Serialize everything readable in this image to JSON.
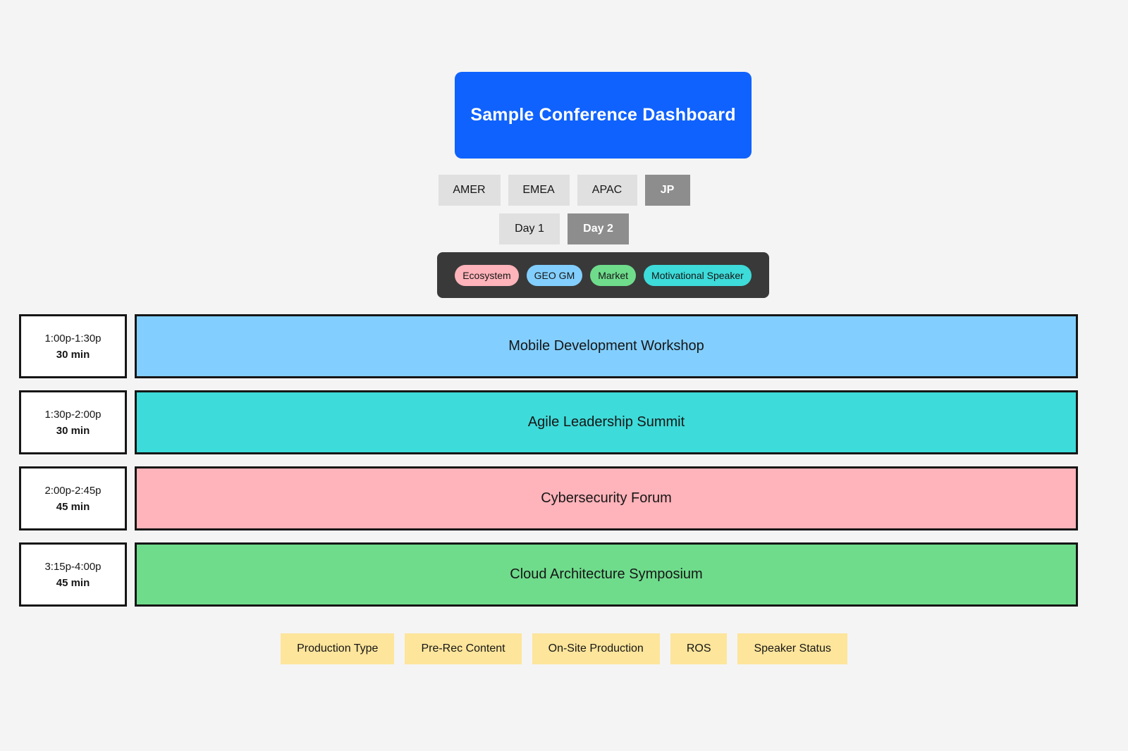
{
  "header": {
    "title": "Sample Conference Dashboard"
  },
  "regions": [
    {
      "label": "AMER",
      "active": false
    },
    {
      "label": "EMEA",
      "active": false
    },
    {
      "label": "APAC",
      "active": false
    },
    {
      "label": "JP",
      "active": true
    }
  ],
  "days": [
    {
      "label": "Day 1",
      "active": false
    },
    {
      "label": "Day 2",
      "active": true
    }
  ],
  "legend": [
    {
      "label": "Ecosystem",
      "color": "#ffb3ba"
    },
    {
      "label": "GEO GM",
      "color": "#82cfff"
    },
    {
      "label": "Market",
      "color": "#6fdc8c"
    },
    {
      "label": "Motivational Speaker",
      "color": "#3ddbd9"
    }
  ],
  "sessions": [
    {
      "time": "1:00p-1:30p",
      "duration": "30 min",
      "title": "Mobile Development Workshop",
      "color": "#82cfff"
    },
    {
      "time": "1:30p-2:00p",
      "duration": "30 min",
      "title": "Agile Leadership Summit",
      "color": "#3ddbd9"
    },
    {
      "time": "2:00p-2:45p",
      "duration": "45 min",
      "title": "Cybersecurity Forum",
      "color": "#ffb3ba"
    },
    {
      "time": "3:15p-4:00p",
      "duration": "45 min",
      "title": "Cloud Architecture Symposium",
      "color": "#6fdc8c"
    }
  ],
  "footer": [
    {
      "label": "Production Type"
    },
    {
      "label": "Pre-Rec Content"
    },
    {
      "label": "On-Site Production"
    },
    {
      "label": "ROS"
    },
    {
      "label": "Speaker Status"
    }
  ]
}
